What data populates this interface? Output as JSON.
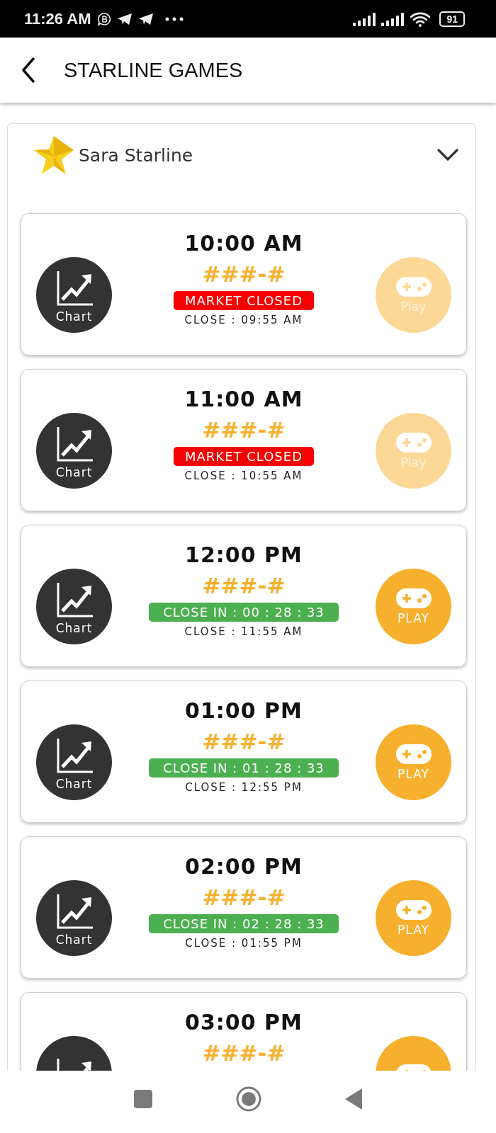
{
  "status_bar": {
    "time": "11:26 AM",
    "battery": "91"
  },
  "app_bar": {
    "title": "STARLINE GAMES"
  },
  "panel": {
    "title": "Sara Starline",
    "expanded": true
  },
  "games": [
    {
      "time": "10:00 AM",
      "result": "###-#",
      "chart_label": "Chart",
      "status": {
        "kind": "closed",
        "text": "MARKET CLOSED"
      },
      "close": "CLOSE : 09:55 AM",
      "play": {
        "label": "Play",
        "disabled": true
      }
    },
    {
      "time": "11:00 AM",
      "result": "###-#",
      "chart_label": "Chart",
      "status": {
        "kind": "closed",
        "text": "MARKET CLOSED"
      },
      "close": "CLOSE : 10:55 AM",
      "play": {
        "label": "Play",
        "disabled": true
      }
    },
    {
      "time": "12:00 PM",
      "result": "###-#",
      "chart_label": "Chart",
      "status": {
        "kind": "open",
        "text": "CLOSE IN : 00 : 28 : 33"
      },
      "close": "CLOSE : 11:55 AM",
      "play": {
        "label": "PLAY",
        "disabled": false
      }
    },
    {
      "time": "01:00 PM",
      "result": "###-#",
      "chart_label": "Chart",
      "status": {
        "kind": "open",
        "text": "CLOSE IN : 01 : 28 : 33"
      },
      "close": "CLOSE : 12:55 PM",
      "play": {
        "label": "PLAY",
        "disabled": false
      }
    },
    {
      "time": "02:00 PM",
      "result": "###-#",
      "chart_label": "Chart",
      "status": {
        "kind": "open",
        "text": "CLOSE IN : 02 : 28 : 33"
      },
      "close": "CLOSE : 01:55 PM",
      "play": {
        "label": "PLAY",
        "disabled": false
      }
    },
    {
      "time": "03:00 PM",
      "result": "###-#",
      "play": {
        "disabled": false
      }
    }
  ]
}
